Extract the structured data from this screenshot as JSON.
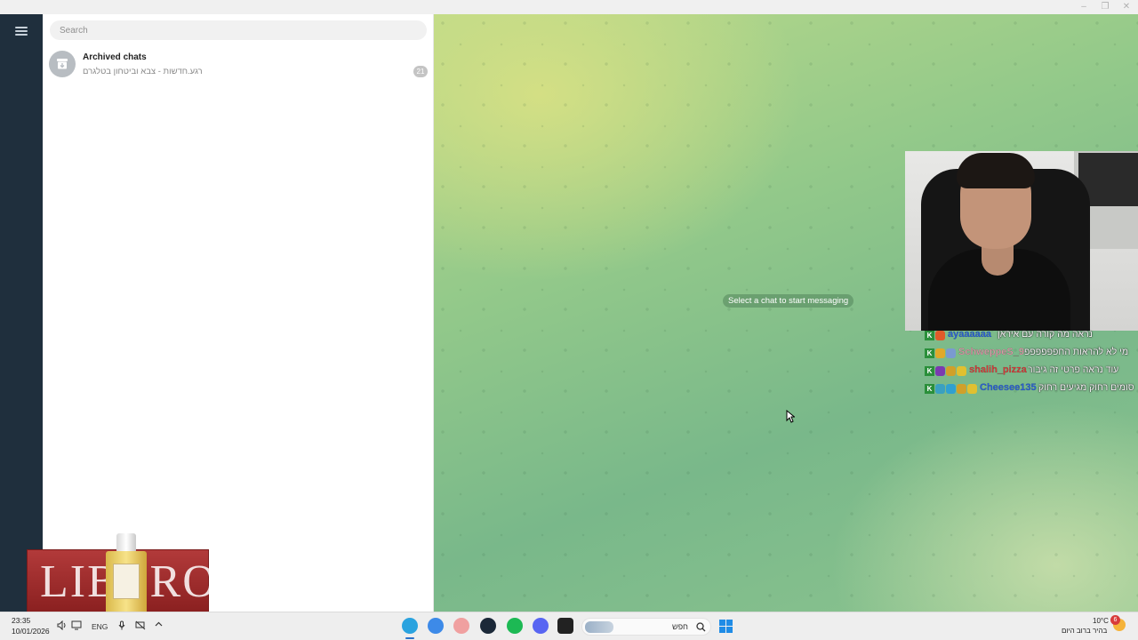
{
  "window": {
    "controls": [
      "–",
      "❐",
      "✕"
    ]
  },
  "sidebar": {
    "search_placeholder": "Search",
    "archived": {
      "title": "Archived chats",
      "subtitle": "רגע.חדשות - צבא וביטחון בטלגרם",
      "badge": "21"
    }
  },
  "main": {
    "empty_message": "Select a chat to start messaging"
  },
  "stream_overlay": {
    "chat": [
      {
        "user": "ayaaaaaa",
        "message": "נראה מה קורה עם איראן",
        "user_color": "#2b5fd9",
        "badges": [
          "#e05a2a"
        ]
      },
      {
        "user": "SchweppeS_9",
        "message": "מי לא להראות החפפפפפפ",
        "user_color": "#d99aa8",
        "badges": [
          "#e0a92a",
          "#7a9ad0"
        ]
      },
      {
        "user": "shalih_pizza",
        "message": "עוד נראה פרטי זה גיבור",
        "user_color": "#d83b3b",
        "badges": [
          "#7a3ab0",
          "#d0a02a",
          "#e0c030"
        ]
      },
      {
        "user": "Cheesee135",
        "message": "סומים רחוק מגיעים רחוק",
        "user_color": "#2b5fd9",
        "badges": [
          "#3aa0c0",
          "#30a0d0",
          "#d0a02a",
          "#e0c030"
        ]
      }
    ],
    "ad_text": "LIBERO"
  },
  "taskbar": {
    "time": "23:35",
    "date": "10/01/2026",
    "language": "ENG",
    "search_text": "חפש",
    "weather_temp": "10°C",
    "weather_desc": "בהיר ברוב היום",
    "notification_count": "6",
    "apps": [
      {
        "name": "telegram",
        "color": "#2aa3df"
      },
      {
        "name": "chrome",
        "color": "#3d8ae8"
      },
      {
        "name": "obs",
        "color": "#f0a0a0"
      },
      {
        "name": "steam",
        "color": "#1b2838"
      },
      {
        "name": "spotify",
        "color": "#1db954"
      },
      {
        "name": "discord",
        "color": "#5865f2"
      },
      {
        "name": "app",
        "color": "#222222"
      }
    ]
  }
}
